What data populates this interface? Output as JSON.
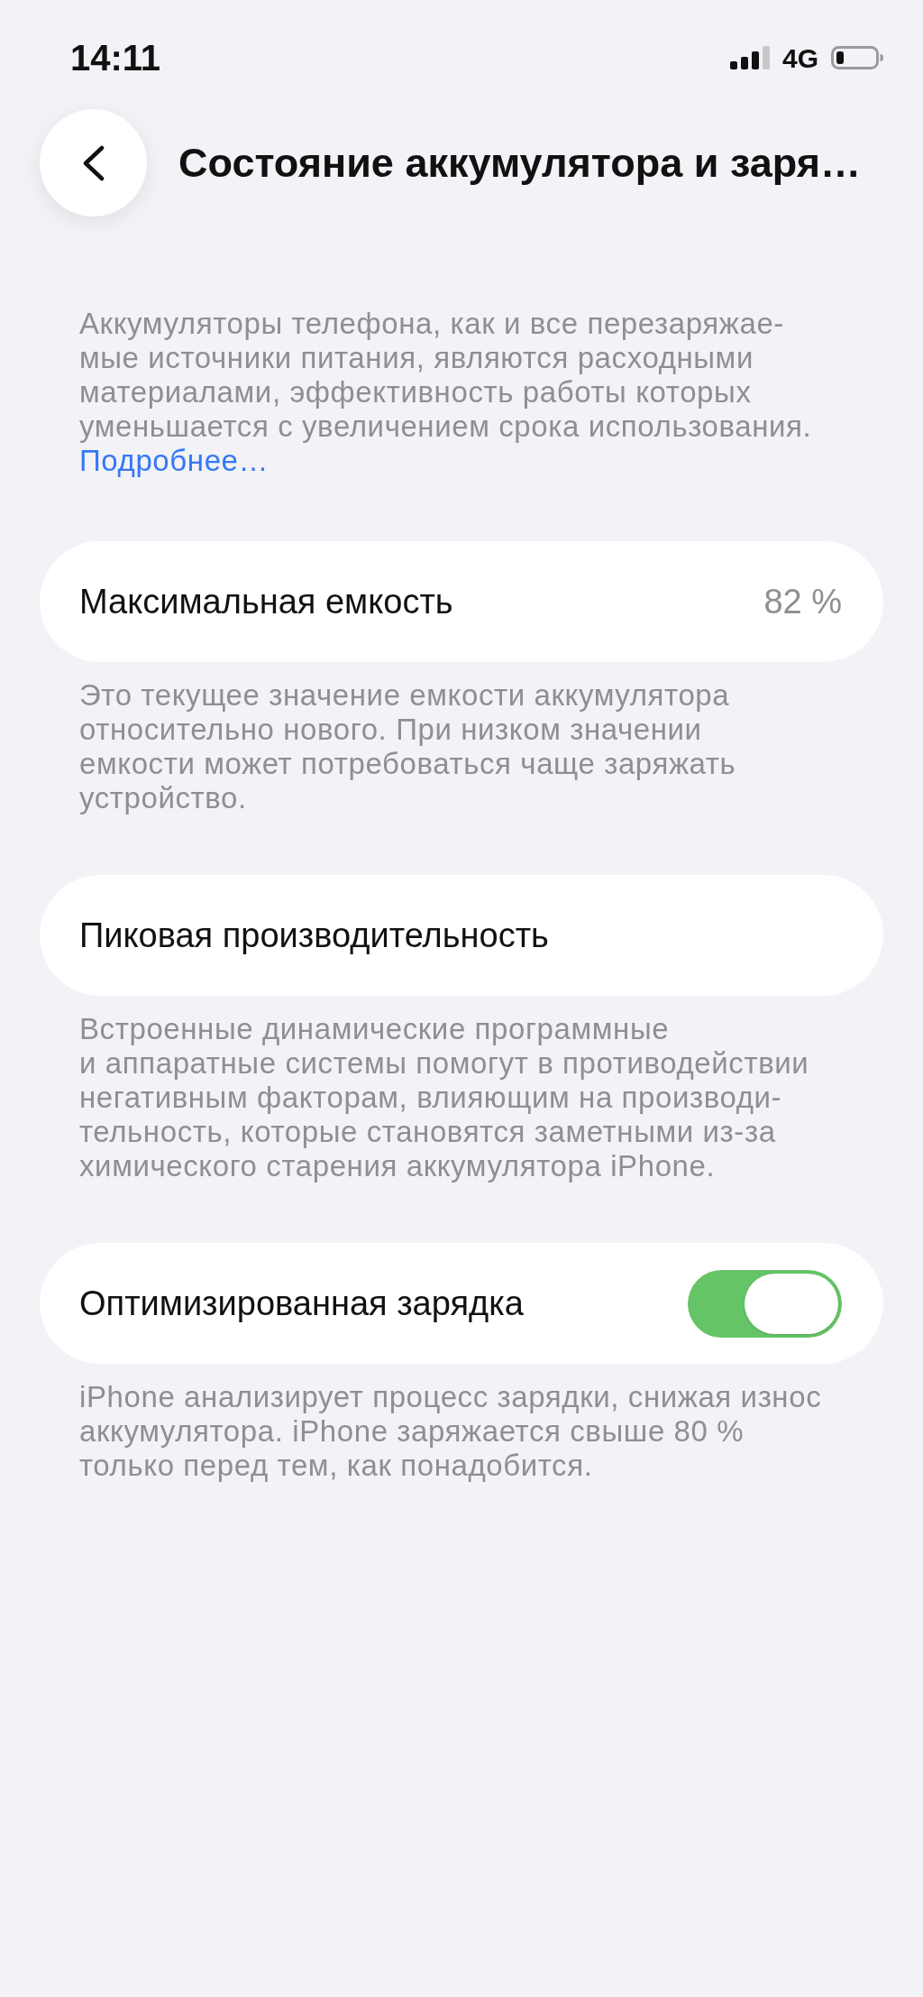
{
  "status_bar": {
    "time": "14:11",
    "network": "4G"
  },
  "nav": {
    "title": "Состояние аккумулятора и заря…"
  },
  "intro": {
    "text": "Аккумуляторы телефона, как и все перезаряжае-\nмые источники питания, являются расходными\nматериалами, эффективность работы которых\nуменьшается с увеличением срока использования.",
    "link": "Подробнее…"
  },
  "sections": [
    {
      "kind": "value",
      "label": "Максимальная емкость",
      "value": "82 %",
      "footer": "Это текущее значение емкости аккумулятора\nотносительно нового. При низком значении\nемкости может потребоваться чаще заряжать\nустройство."
    },
    {
      "kind": "plain",
      "label": "Пиковая производительность",
      "footer": "Встроенные динамические программные\nи аппаратные системы помогут в противодействии\nнегативным факторам, влияющим на производи-\nтельность, которые становятся заметными из-за\nхимического старения аккумулятора iPhone."
    },
    {
      "kind": "toggle",
      "label": "Оптимизированная зарядка",
      "on": true,
      "footer": "iPhone анализирует процесс зарядки, снижая износ\nаккумулятора. iPhone заряжается свыше 80 %\nтолько перед тем, как понадобится."
    }
  ]
}
